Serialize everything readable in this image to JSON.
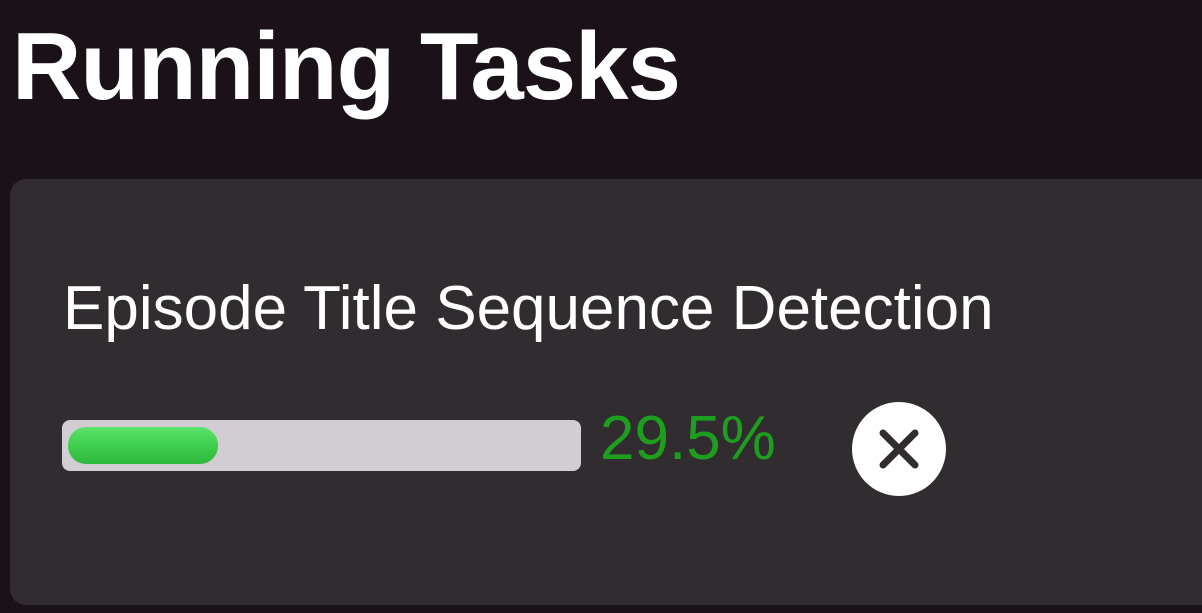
{
  "header": {
    "title": "Running Tasks"
  },
  "tasks": [
    {
      "name": "Episode Title Sequence Detection",
      "progress_percent": 29.5,
      "progress_label": "29.5%",
      "cancel_icon": "close-icon"
    }
  ],
  "colors": {
    "background": "#1b1119",
    "card": "#302c30",
    "progress_track": "#d2cdd2",
    "progress_fill": "#3ccc4a",
    "progress_text": "#1e9e1e",
    "cancel_button": "#ffffff",
    "cancel_icon": "#302c30"
  }
}
